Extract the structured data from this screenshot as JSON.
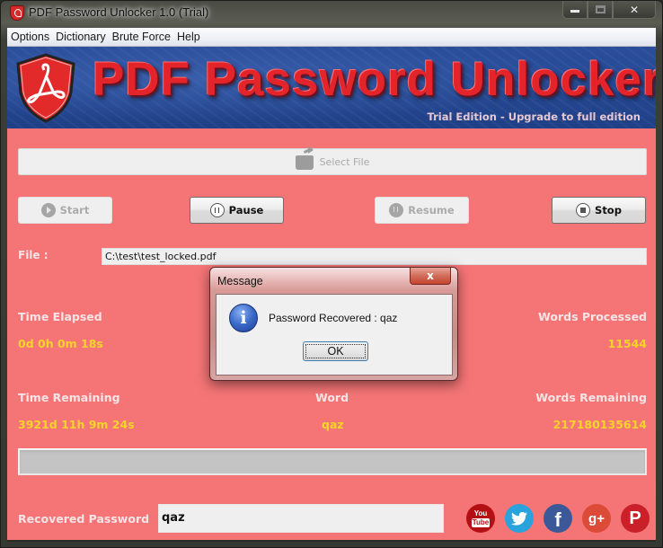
{
  "window": {
    "title": "PDF Password Unlocker 1.0 (Trial)",
    "controls": {
      "minimize": "minimize",
      "maximize": "maximize",
      "close": "✕"
    }
  },
  "menu": {
    "items": [
      {
        "label": "Options"
      },
      {
        "label": "Dictionary"
      },
      {
        "label": "Brute Force"
      },
      {
        "label": "Help"
      }
    ]
  },
  "banner": {
    "title": "PDF Password Unlocker",
    "subtitle": "Trial Edition - Upgrade to full edition"
  },
  "toolbar": {
    "select_file_label": "Select File",
    "start_label": "Start",
    "pause_label": "Pause",
    "resume_label": "Resume",
    "stop_label": "Stop"
  },
  "file": {
    "label": "File :",
    "value": "C:\\test\\test_locked.pdf"
  },
  "stats": {
    "time_elapsed_label": "Time Elapsed",
    "time_elapsed_value": "0d 0h 0m 18s",
    "words_processed_label": "Words Processed",
    "words_processed_value": "11544",
    "time_remaining_label": "Time Remaining",
    "time_remaining_value": "3921d 11h 9m 24s",
    "word_label": "Word",
    "word_value": "qaz",
    "words_remaining_label": "Words Remaining",
    "words_remaining_value": "217180135614"
  },
  "progress": {
    "value_percent": 0
  },
  "recovered": {
    "label": "Recovered Password",
    "value": "qaz"
  },
  "social": [
    {
      "name": "youtube",
      "line1": "You",
      "line2": "Tube"
    },
    {
      "name": "twitter",
      "glyph": "🐦"
    },
    {
      "name": "facebook",
      "glyph": "f"
    },
    {
      "name": "google-plus",
      "glyph": "g+"
    },
    {
      "name": "pinterest",
      "glyph": "P"
    }
  ],
  "dialog": {
    "title": "Message",
    "close": "x",
    "message": "Password Recovered : qaz",
    "ok_label": "OK",
    "icon": "i"
  },
  "colors": {
    "panel_bg": "#f57576",
    "value_yellow": "#f6d32a",
    "label_light": "#f6e4e6",
    "banner_blue": "#274a95",
    "banner_red": "#e3242b"
  }
}
